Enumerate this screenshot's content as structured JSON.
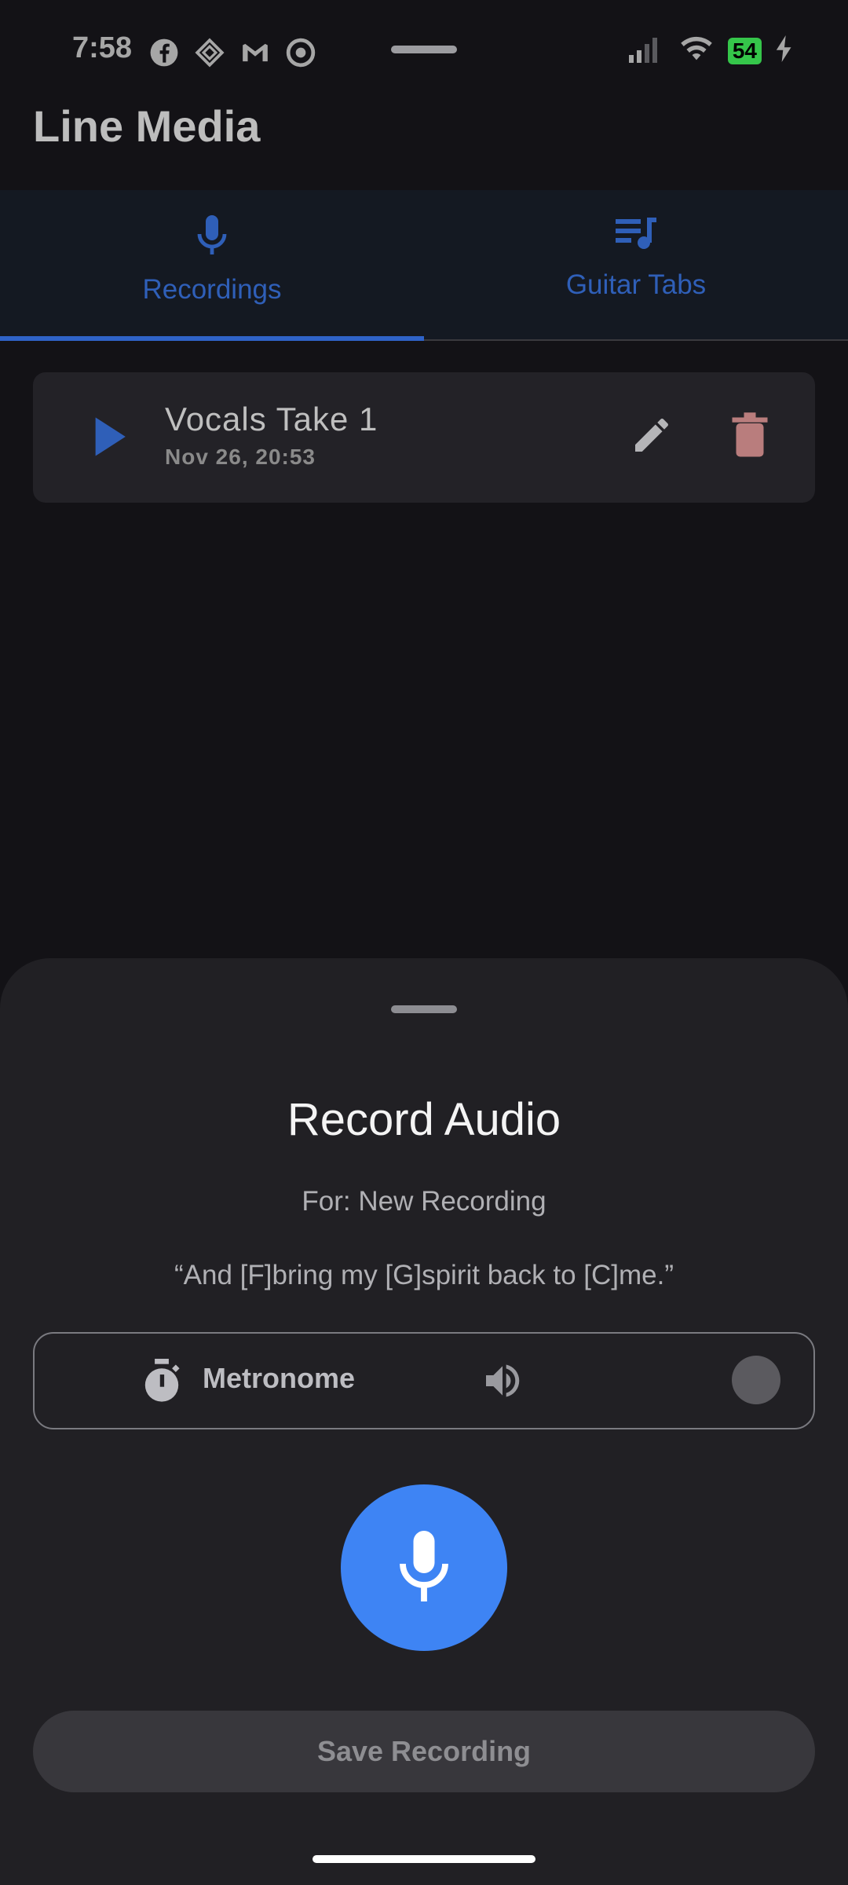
{
  "status": {
    "time": "7:58",
    "battery": "54",
    "icons_left": [
      "facebook-icon",
      "diamond-app-icon",
      "gmail-icon",
      "sync-app-icon"
    ],
    "icons_right": [
      "signal-icon",
      "wifi-icon",
      "battery-icon",
      "charging-icon"
    ]
  },
  "app": {
    "title": "Line Media"
  },
  "tabs": [
    {
      "label": "Recordings",
      "icon": "mic-icon",
      "selected": true
    },
    {
      "label": "Guitar Tabs",
      "icon": "queue-music-icon",
      "selected": false
    }
  ],
  "recordings": [
    {
      "title": "Vocals Take 1",
      "date": "Nov 26, 20:53"
    }
  ],
  "sheet": {
    "title": "Record Audio",
    "for_text": "For: New Recording",
    "quote": "“And [F]bring my [G]spirit back to [C]me.”",
    "metronome_label": "Metronome",
    "metronome_enabled": false,
    "save_label": "Save Recording"
  },
  "colors": {
    "accent": "#3e84f4",
    "tab_active": "#2f63c8",
    "background": "#131216",
    "sheet": "#212024",
    "delete_icon": "#b97d7d"
  }
}
